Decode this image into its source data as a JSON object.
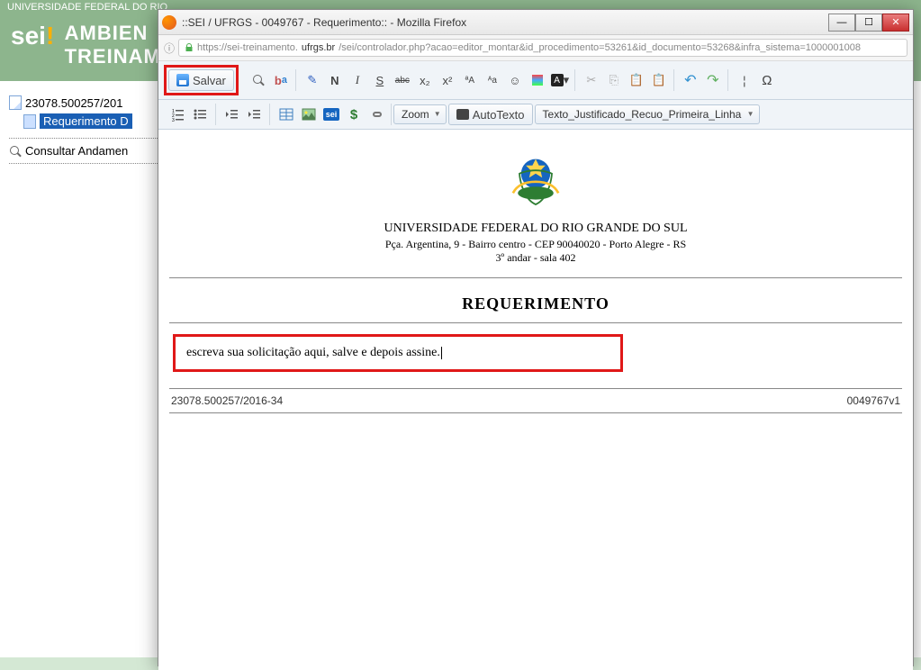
{
  "main": {
    "top_text": "UNIVERSIDADE FEDERAL DO RIO",
    "logo_text": "sei",
    "header_line1": "AMBIEN",
    "header_line2": "TREINAMENTO"
  },
  "tree": {
    "root": "23078.500257/201",
    "child": "Requerimento D",
    "consult": "Consultar Andamen"
  },
  "popup": {
    "title": "::SEI / UFRGS - 0049767 - Requerimento:: - Mozilla Firefox",
    "url_prefix": "https://sei-treinamento.",
    "url_domain": "ufrgs.br",
    "url_rest": "/sei/controlador.php?acao=editor_montar&id_procedimento=53261&id_documento=53268&infra_sistema=1000001008"
  },
  "toolbar": {
    "save": "Salvar",
    "zoom": "Zoom",
    "autotext": "AutoTexto",
    "style": "Texto_Justificado_Recuo_Primeira_Linha",
    "icons": {
      "find": "find-icon",
      "remove_fmt": "remove-format-icon",
      "pen": "pen-icon",
      "bold": "N",
      "italic": "I",
      "strike": "S",
      "abc": "abc",
      "sub": "x₂",
      "sup": "x²",
      "case_upper": "ªA",
      "case_lower": "ᴬa",
      "face": "☺",
      "bg": "bg",
      "black": "■",
      "cut": "cut",
      "copy": "copy",
      "paste": "paste",
      "paste2": "paste-special",
      "undo": "↶",
      "redo": "↷",
      "pipe": "¦",
      "omega": "Ω",
      "ol": "ol",
      "ul": "ul",
      "outdent": "outdent",
      "indent": "indent",
      "img": "img",
      "upload": "upload",
      "sei": "sei",
      "dollar": "$",
      "link": "link"
    }
  },
  "doc": {
    "university": "UNIVERSIDADE FEDERAL DO RIO GRANDE DO SUL",
    "address": "Pça. Argentina, 9 - Bairro centro - CEP 90040020 - Porto Alegre - RS",
    "floor": "3º andar - sala 402",
    "title": "REQUERIMENTO",
    "body": "escreva sua solicitação aqui, salve e depois assine.",
    "footer_left": "23078.500257/2016-34",
    "footer_right": "0049767v1"
  }
}
